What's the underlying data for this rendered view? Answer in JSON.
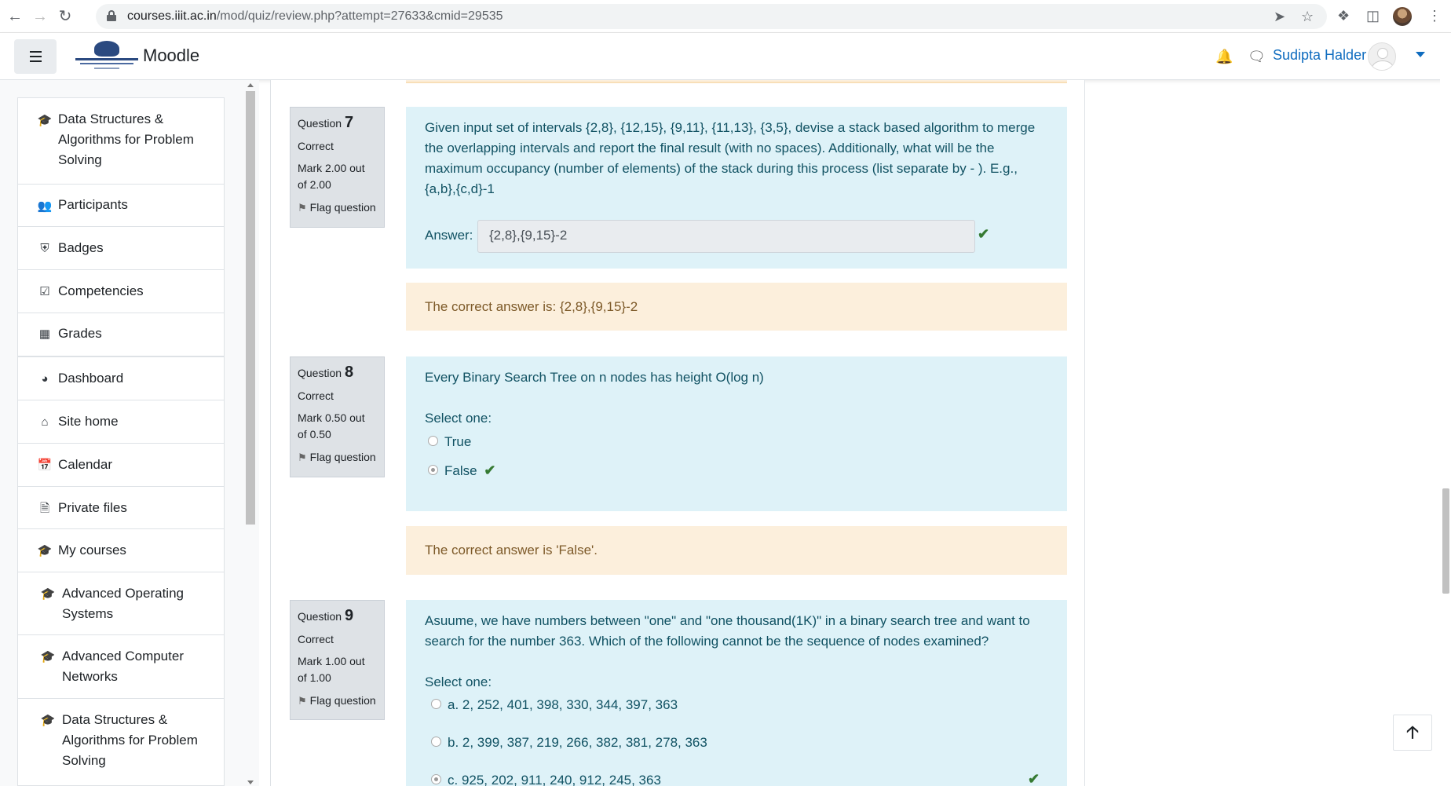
{
  "browser": {
    "url_host": "courses.iiit.ac.in",
    "url_path": "/mod/quiz/review.php?attempt=27633&cmid=29535",
    "back_icon": "arrow-left-icon",
    "forward_icon": "arrow-right-icon",
    "reload_icon": "reload-icon"
  },
  "header": {
    "brand": "Moodle",
    "user_name": "Sudipta Halder"
  },
  "sidebar": {
    "course_items": [
      {
        "label": "Data Structures & Algorithms for Problem Solving",
        "icon": "graduation-cap-icon"
      },
      {
        "label": "Participants",
        "icon": "users-icon"
      },
      {
        "label": "Badges",
        "icon": "shield-icon"
      },
      {
        "label": "Competencies",
        "icon": "check-square-icon"
      },
      {
        "label": "Grades",
        "icon": "table-icon"
      }
    ],
    "site_items": [
      {
        "label": "Dashboard",
        "icon": "tachometer-icon"
      },
      {
        "label": "Site home",
        "icon": "home-icon"
      },
      {
        "label": "Calendar",
        "icon": "calendar-icon"
      },
      {
        "label": "Private files",
        "icon": "file-icon"
      },
      {
        "label": "My courses",
        "icon": "graduation-cap-icon"
      }
    ],
    "my_courses": [
      {
        "label": "Advanced Operating Systems"
      },
      {
        "label": "Advanced Computer Networks"
      },
      {
        "label": "Data Structures & Algorithms for Problem Solving"
      }
    ]
  },
  "questions": [
    {
      "label": "Question",
      "number": "7",
      "state": "Correct",
      "grade": "Mark 2.00 out of 2.00",
      "flag": "Flag question",
      "text": "Given input set of intervals {2,8}, {12,15}, {9,11}, {11,13}, {3,5}, devise a stack based algorithm to merge the overlapping intervals and report the final result (with no spaces). Additionally, what will be the maximum occupancy (number of elements) of the stack during this process (list separate by - ). E.g., {a,b},{c,d}-1",
      "answer_label": "Answer:",
      "answer_value": "{2,8},{9,15}-2",
      "feedback": "The correct answer is: {2,8},{9,15}-2"
    },
    {
      "label": "Question",
      "number": "8",
      "state": "Correct",
      "grade": "Mark 0.50 out of 0.50",
      "flag": "Flag question",
      "text": "Every Binary Search Tree on n nodes has height O(log n)",
      "prompt": "Select one:",
      "options": [
        {
          "label": "True",
          "selected": false
        },
        {
          "label": "False",
          "selected": true
        }
      ],
      "feedback": "The correct answer is 'False'."
    },
    {
      "label": "Question",
      "number": "9",
      "state": "Correct",
      "grade": "Mark 1.00 out of 1.00",
      "flag": "Flag question",
      "text": "Asuume, we have numbers between \"one\" and \"one thousand(1K)\" in a binary search tree and want to search for the number 363. Which of the following cannot be the sequence of nodes examined?",
      "prompt": "Select one:",
      "options": [
        {
          "label": "a. 2, 252, 401, 398, 330, 344, 397, 363",
          "selected": false
        },
        {
          "label": "b. 2, 399, 387, 219, 266, 382, 381, 278, 363",
          "selected": false
        },
        {
          "label": "c. 925, 202, 911, 240, 912, 245, 363",
          "selected": true
        }
      ]
    }
  ],
  "colors": {
    "formulation_bg": "#def2f8",
    "formulation_text": "#115263",
    "feedback_bg": "#fcefdc",
    "feedback_text": "#7d5a29",
    "correct_check": "#357a32",
    "link": "#0f6cbf"
  }
}
